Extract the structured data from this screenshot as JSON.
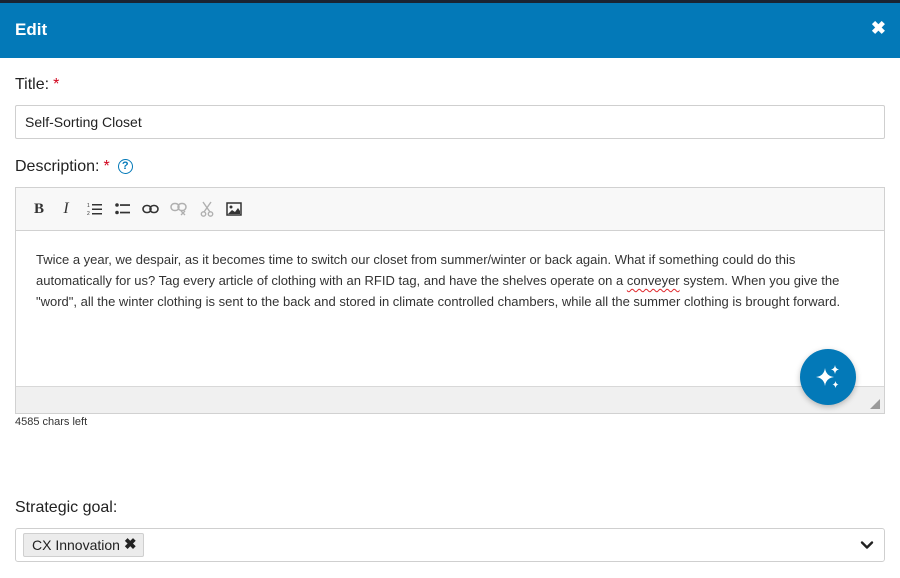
{
  "dialog": {
    "title": "Edit",
    "close_glyph": "✖"
  },
  "fields": {
    "title_label": "Title:",
    "title_value": "Self-Sorting Closet",
    "description_label": "Description:",
    "required_mark": "*",
    "help_glyph": "?",
    "strategic_goal_label": "Strategic goal:"
  },
  "toolbar": {
    "bold": "B",
    "italic": "I",
    "icons": [
      "bold-icon",
      "italic-icon",
      "numbered-list-icon",
      "bulleted-list-icon",
      "link-icon",
      "unlink-icon",
      "cut-icon",
      "image-icon"
    ]
  },
  "description": {
    "text_before": "Twice a year, we despair, as it becomes time to switch our closet from summer/winter or back again. What if something could do this automatically for us? Tag every article of clothing with an RFID tag, and have the shelves operate on a ",
    "misspelled_word": "conveyer",
    "text_after": " system. When you give the \"word\", all the winter clothing is sent to the back and stored in climate controlled chambers, while all the summer clothing is brought forward.",
    "chars_left": "4585 chars left"
  },
  "strategic_goal": {
    "selected_tag": "CX Innovation",
    "remove_glyph": "✖"
  },
  "colors": {
    "header": "#0379b8",
    "required": "#d0021b",
    "ai_button": "#0379b8"
  }
}
